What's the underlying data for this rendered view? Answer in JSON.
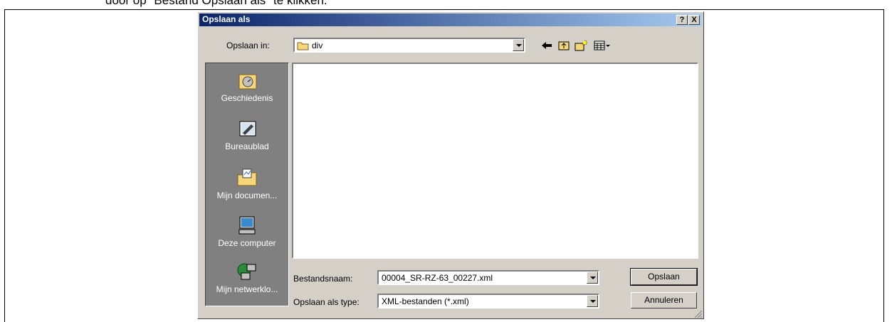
{
  "document": {
    "text_fragment": "door op \"Bestand Opslaan als\" te klikken."
  },
  "dialog": {
    "title": "Opslaan als",
    "help_button": "?",
    "close_button": "X",
    "save_in_label": "Opslaan in:",
    "save_in_value": "div",
    "places": [
      {
        "label": "Geschiedenis",
        "icon": "history-icon"
      },
      {
        "label": "Bureaublad",
        "icon": "desktop-icon"
      },
      {
        "label": "Mijn documen...",
        "icon": "my-documents-icon"
      },
      {
        "label": "Deze computer",
        "icon": "my-computer-icon"
      },
      {
        "label": "Mijn netwerklo...",
        "icon": "network-places-icon"
      }
    ],
    "filename_label": "Bestandsnaam:",
    "filename_value": "00004_SR-RZ-63_00227.xml",
    "filetype_label": "Opslaan als type:",
    "filetype_value": "XML-bestanden (*.xml)",
    "save_button": "Opslaan",
    "cancel_button": "Annuleren",
    "toolbar_icons": [
      "back-arrow-icon",
      "up-folder-icon",
      "new-folder-icon",
      "view-menu-icon"
    ]
  }
}
